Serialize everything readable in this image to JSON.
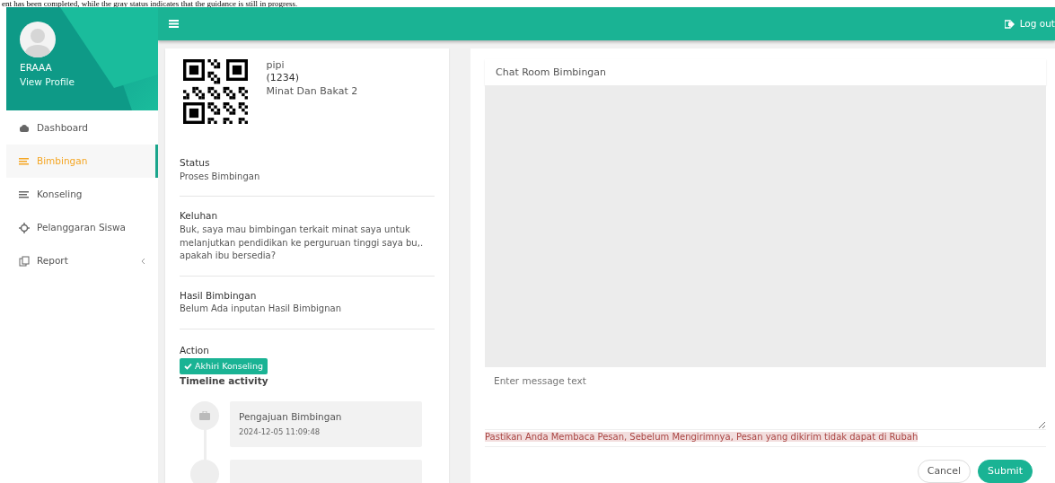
{
  "caption": "ent has been completed, while the gray status indicates that the guidance is still in progress.",
  "sidebar": {
    "user": "ERAAA",
    "profile_link": "View Profile",
    "items": [
      {
        "label": "Dashboard",
        "kind": "dashboard",
        "selected": false
      },
      {
        "label": "Bimbingan",
        "kind": "lines",
        "selected": true
      },
      {
        "label": "Konseling",
        "kind": "lines",
        "selected": false
      },
      {
        "label": "Pelanggaran Siswa",
        "kind": "crosshair",
        "selected": false
      },
      {
        "label": "Report",
        "kind": "copy",
        "selected": false,
        "has_children": true
      }
    ]
  },
  "topbar": {
    "logout": "Log out"
  },
  "student": {
    "name": "pipi",
    "id": "(1234)",
    "topic": "Minat Dan Bakat 2"
  },
  "fields": [
    {
      "label": "Status",
      "value": "Proses Bimbingan"
    },
    {
      "label": "Keluhan",
      "value": "Buk, saya mau bimbingan terkait minat saya untuk melanjutkan pendidikan ke perguruan tinggi saya bu,. apakah ibu bersedia?"
    },
    {
      "label": "Hasil Bimbingan",
      "value": "Belum Ada inputan Hasil Bimbignan"
    }
  ],
  "action": {
    "label": "Action",
    "button": "Akhiri Konseling"
  },
  "timeline": {
    "title": "Timeline activity",
    "items": [
      {
        "kind": "briefcase",
        "title": "Pengajuan Bimbingan",
        "time": "2024-12-05 11:09:48"
      },
      {
        "kind": "cut"
      }
    ]
  },
  "chat": {
    "title": "Chat Room Bimbingan",
    "placeholder": "Enter message text",
    "warning": "Pastikan Anda Membaca Pesan, Sebelum Mengirimnya, Pesan yang dikirim tidak dapat di Rubah",
    "buttons": [
      {
        "label": "Cancel",
        "kind": "outline"
      },
      {
        "label": "Submit",
        "kind": "primary"
      }
    ]
  }
}
